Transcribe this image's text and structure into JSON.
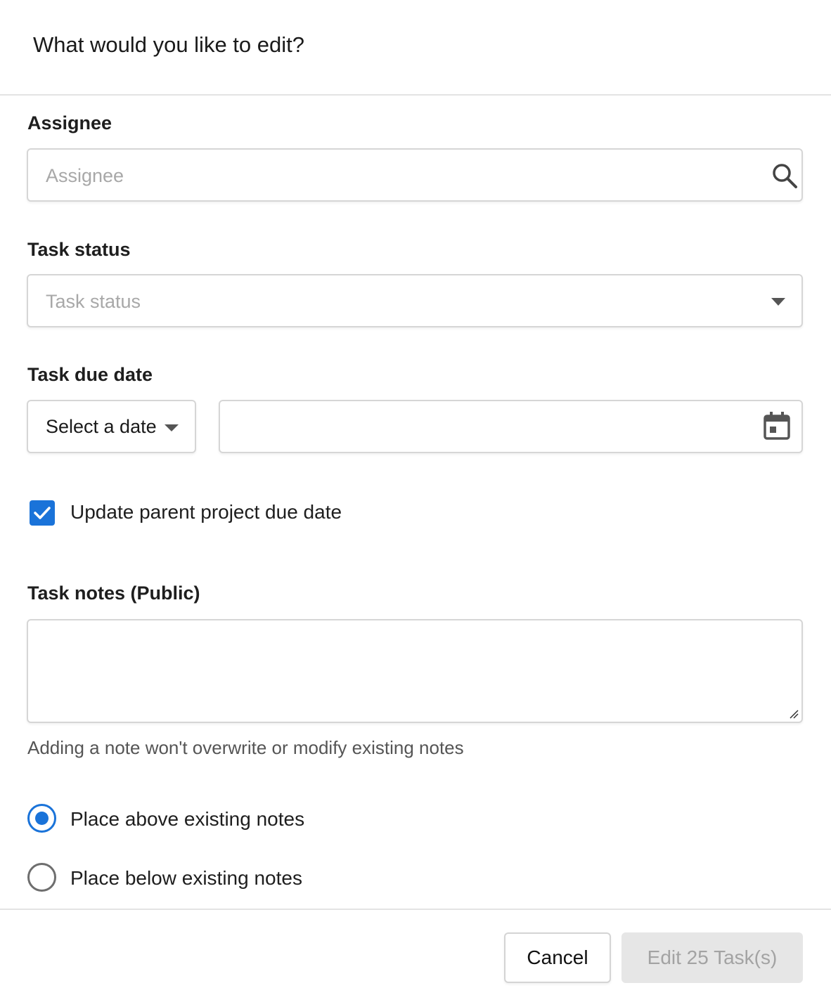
{
  "dialog": {
    "title": "What would you like to edit?"
  },
  "assignee": {
    "label": "Assignee",
    "placeholder": "Assignee",
    "icon": "search-icon"
  },
  "task_status": {
    "label": "Task status",
    "placeholder": "Task status",
    "icon": "chevron-down-icon"
  },
  "due_date": {
    "label": "Task due date",
    "select_value": "Select a date",
    "date_value": "",
    "icon": "calendar-icon"
  },
  "update_parent": {
    "label": "Update parent project due date",
    "checked": true
  },
  "notes": {
    "label": "Task notes (Public)",
    "value": "",
    "helper": "Adding a note won't overwrite or modify existing notes"
  },
  "placement": {
    "options": [
      {
        "label": "Place above existing notes",
        "selected": true
      },
      {
        "label": "Place below existing notes",
        "selected": false
      }
    ]
  },
  "footer": {
    "cancel_label": "Cancel",
    "submit_label": "Edit 25 Task(s)"
  },
  "colors": {
    "accent": "#1a73d9",
    "disabled_bg": "#e6e6e6",
    "disabled_text": "#a3a3a3"
  }
}
